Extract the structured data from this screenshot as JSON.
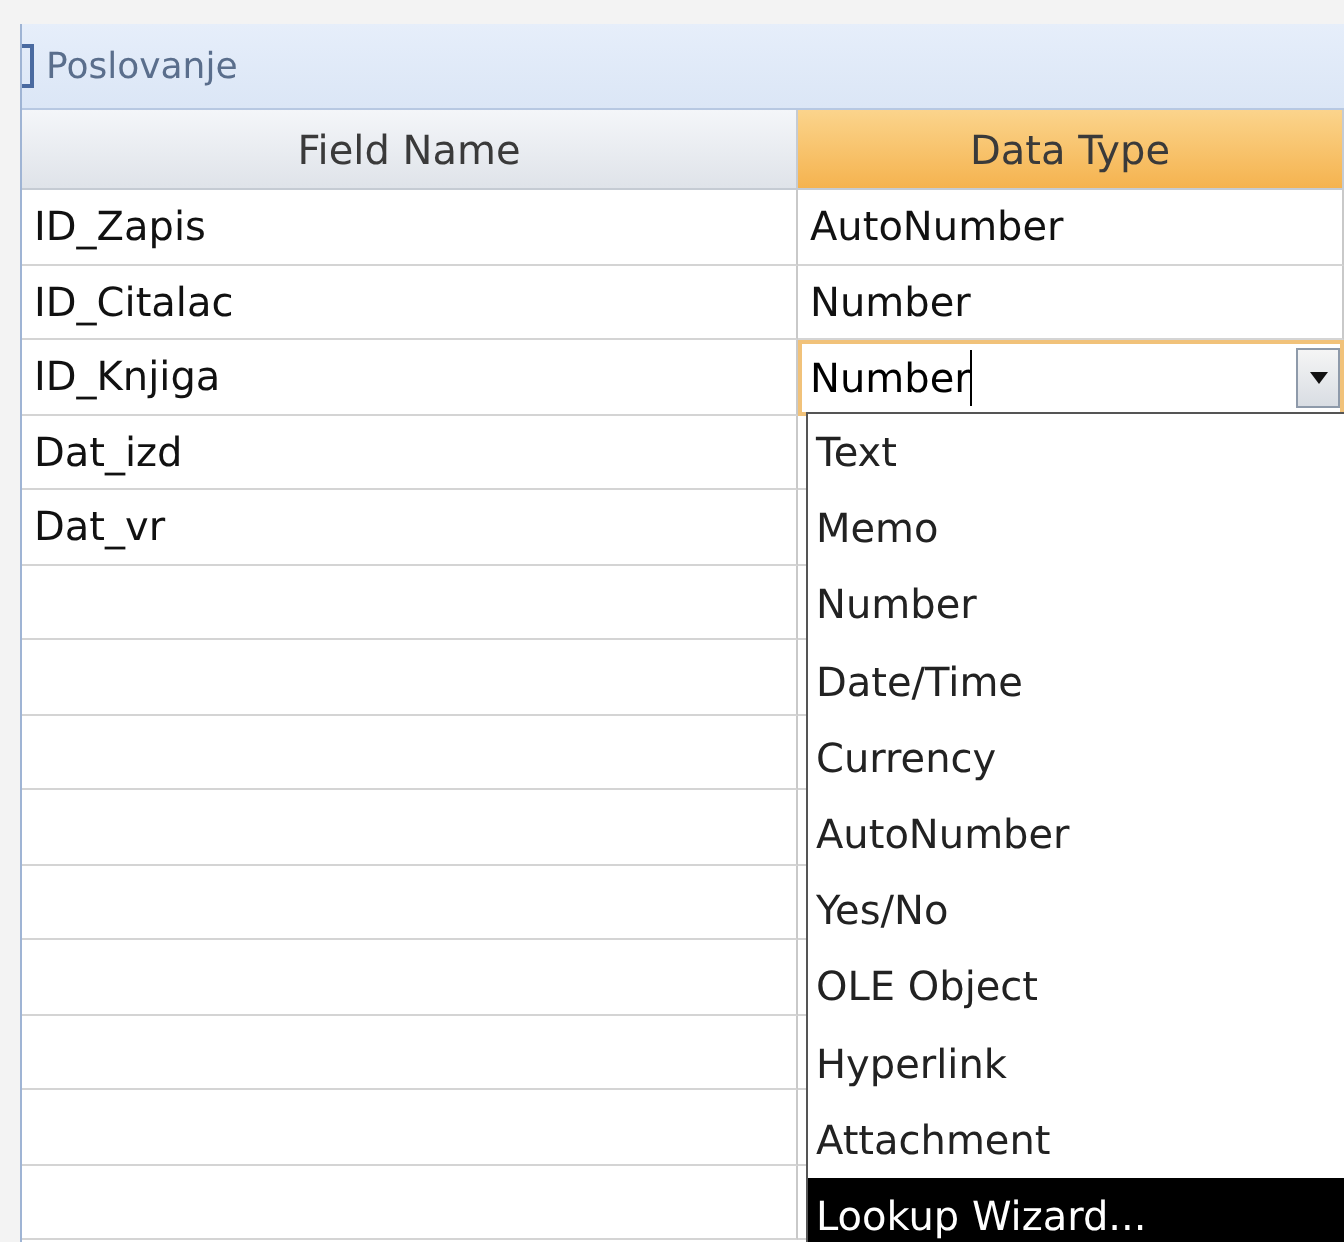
{
  "window": {
    "title": "Poslovanje"
  },
  "table": {
    "columns": [
      {
        "label": "Field Name",
        "selected": false
      },
      {
        "label": "Data Type",
        "selected": true
      }
    ],
    "rows": [
      {
        "field_name": "ID_Zapis",
        "data_type": "AutoNumber",
        "selected": false
      },
      {
        "field_name": "ID_Citalac",
        "data_type": "Number",
        "selected": false
      },
      {
        "field_name": "ID_Knjiga",
        "data_type": "Number",
        "selected": true
      },
      {
        "field_name": "Dat_izd",
        "selected": false
      },
      {
        "field_name": "Dat_vr",
        "selected": false
      }
    ]
  },
  "dropdown": {
    "options": [
      {
        "label": "Text",
        "selected": false
      },
      {
        "label": "Memo",
        "selected": false
      },
      {
        "label": "Number",
        "selected": false
      },
      {
        "label": "Date/Time",
        "selected": false
      },
      {
        "label": "Currency",
        "selected": false
      },
      {
        "label": "AutoNumber",
        "selected": false
      },
      {
        "label": "Yes/No",
        "selected": false
      },
      {
        "label": "OLE Object",
        "selected": false
      },
      {
        "label": "Hyperlink",
        "selected": false
      },
      {
        "label": "Attachment",
        "selected": false
      },
      {
        "label": "Lookup Wizard...",
        "selected": true
      }
    ]
  }
}
